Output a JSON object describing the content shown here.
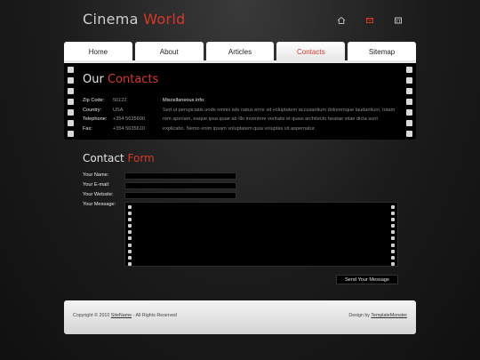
{
  "header": {
    "logo_first": "Cinema",
    "logo_second": "World",
    "icons": [
      "home-icon",
      "mail-icon",
      "sitemap-icon"
    ]
  },
  "nav": {
    "tabs": [
      {
        "label": "Home"
      },
      {
        "label": "About"
      },
      {
        "label": "Articles"
      },
      {
        "label": "Contacts"
      },
      {
        "label": "Sitemap"
      }
    ],
    "active": "Contacts"
  },
  "contacts": {
    "title_first": "Our",
    "title_second": "Contacts",
    "address": [
      {
        "key": "Zip Code:",
        "value": "50122"
      },
      {
        "key": "Country:",
        "value": "USA"
      },
      {
        "key": "Telephone:",
        "value": "+354 5635600"
      },
      {
        "key": "Fax:",
        "value": "+354 5635610"
      }
    ],
    "misc_title": "Miscellaneous info:",
    "misc_text": "Sed ut perspiciatis unde omnis iste natus error sit voluptatem accusantium doloremque laudantium, totam rem aperiam, eaque ipsa quae ab illo inventore veritatis et quasi architecto beatae vitae dicta sunt explicabo. Nemo enim ipsam voluptatem quia voluptas sit aspernatur."
  },
  "form": {
    "title_first": "Contact",
    "title_second": "Form",
    "name_label": "Your Name:",
    "email_label": "Your E-mail:",
    "website_label": "Your Website:",
    "message_label": "Your Message:",
    "name_value": "",
    "email_value": "",
    "website_value": "",
    "message_value": "",
    "submit_label": "Send Your Message"
  },
  "footer": {
    "copy_prefix": "Copyright © 2010",
    "copy_link": "SiteName",
    "copy_suffix": "- All Rights Reserved",
    "design_prefix": "Design by",
    "design_link": "TemplateMonster"
  },
  "colors": {
    "accent": "#d8372c",
    "background": "#1b1b1b",
    "panel": "#000000"
  }
}
